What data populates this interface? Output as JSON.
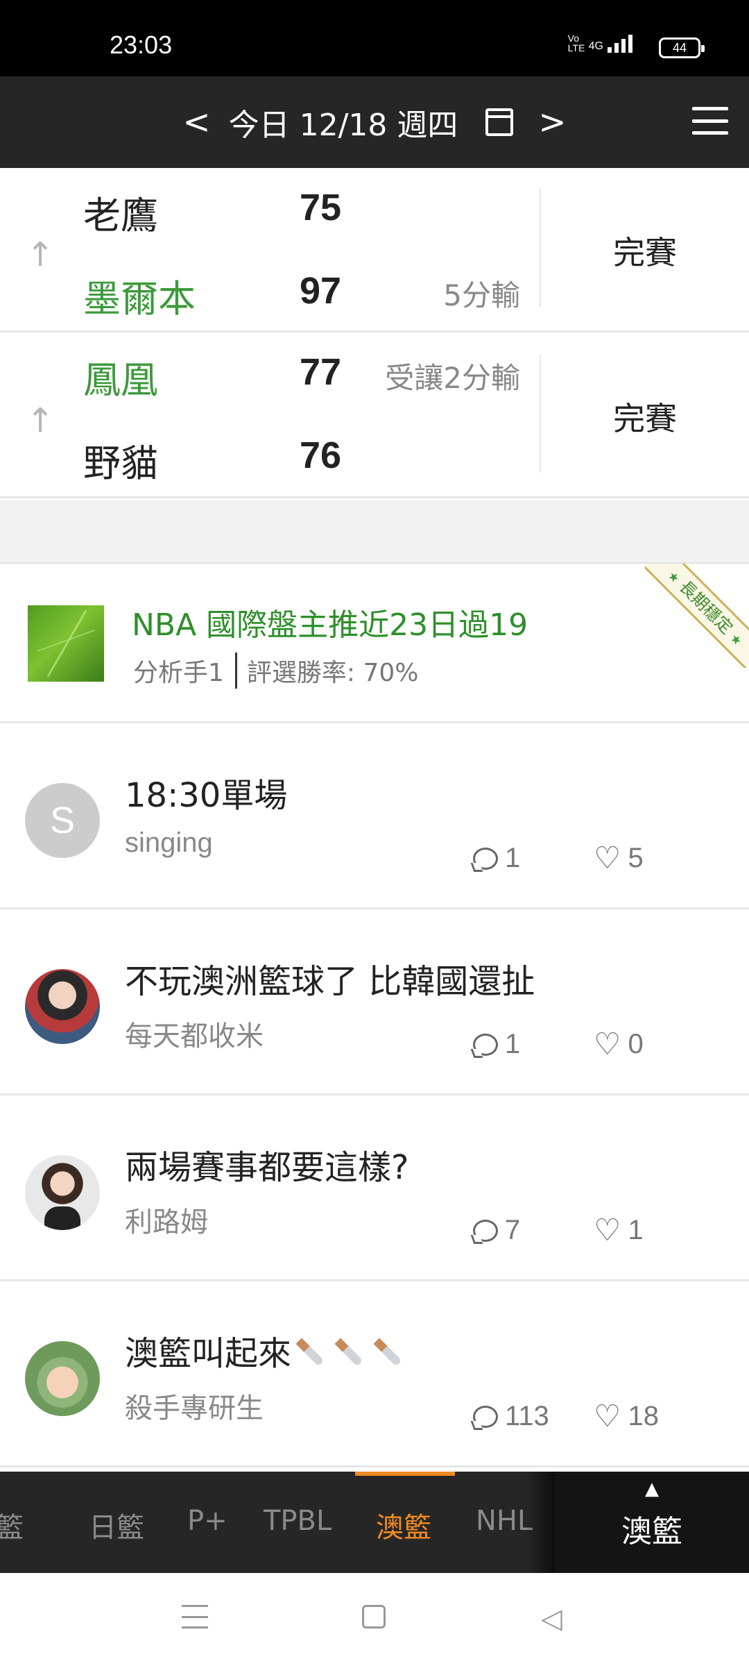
{
  "status_bar": {
    "time": "23:03",
    "network": "4G",
    "volte": "Vo LTE",
    "battery": "44"
  },
  "header": {
    "prev": "<",
    "date_label": "今日 12/18 週四",
    "next": ">",
    "icons": [
      "calendar-icon",
      "menu-icon"
    ]
  },
  "games": [
    {
      "home": "老鷹",
      "home_score": "75",
      "away": "墨爾本",
      "away_score": "97",
      "spread": "5分輸",
      "status": "完賽"
    },
    {
      "home": "鳳凰",
      "home_score": "77",
      "away": "野貓",
      "away_score": "76",
      "spread": "受讓2分輸",
      "status": "完賽"
    }
  ],
  "promo": {
    "title": "NBA 國際盤主推近23日過19",
    "analyst": "分析手1",
    "win_rate": "評選勝率: 70%",
    "ribbon": "長期穩定",
    "accent": "#2e8f2a"
  },
  "posts": [
    {
      "avatar_letter": "S",
      "text": "18:30單場",
      "author": "singing",
      "comments": "1",
      "likes": "5"
    },
    {
      "text": "不玩澳洲籃球了 比韓國還扯",
      "author": "每天都收米",
      "comments": "1",
      "likes": "0"
    },
    {
      "text": "兩場賽事都要這樣?",
      "author": "利路姆",
      "comments": "7",
      "likes": "1"
    },
    {
      "text": "澳籃叫起來",
      "author": "殺手專研生",
      "comments": "113",
      "likes": "18"
    }
  ],
  "tabs": {
    "items": [
      "籃",
      "日籃",
      "P+",
      "TPBL",
      "澳籃",
      "NHL"
    ],
    "active_index": 4,
    "current_label": "澳籃",
    "current_caret": "▲",
    "accent": "#f08a24"
  },
  "system_nav": {
    "back": "◁"
  }
}
